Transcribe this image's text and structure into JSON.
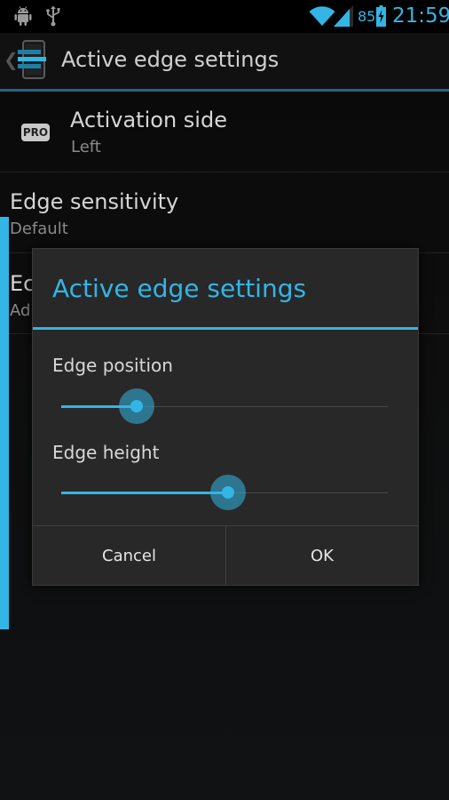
{
  "status_bar": {
    "left_icons": [
      "android-debug-icon",
      "usb-icon"
    ],
    "right_icons": [
      "wifi-icon",
      "signal-icon",
      "battery-charging-icon"
    ],
    "battery_percent": "85",
    "clock": "21:59"
  },
  "action_bar": {
    "app_icon": "edge-settings-app-icon",
    "title": "Active edge settings"
  },
  "settings": {
    "activation_side": {
      "badge": "PRO",
      "title": "Activation side",
      "summary": "Left"
    },
    "edge_sensitivity": {
      "title": "Edge sensitivity",
      "summary": "Default"
    },
    "partial_item": {
      "title": "Ec",
      "summary": "Ad"
    }
  },
  "dialog": {
    "title": "Active edge settings",
    "edge_position": {
      "label": "Edge position",
      "value_fraction": 0.23
    },
    "edge_height": {
      "label": "Edge height",
      "value_fraction": 0.51
    },
    "buttons": {
      "cancel": "Cancel",
      "ok": "OK"
    }
  },
  "colors": {
    "accent": "#33b5e5",
    "background": "#0b0b0b",
    "dialog_background": "#282828"
  }
}
